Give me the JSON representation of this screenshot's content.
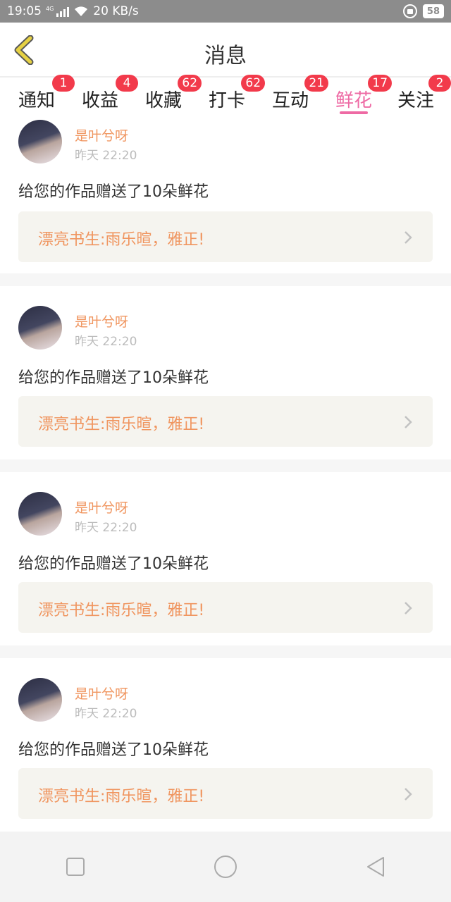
{
  "status_bar": {
    "time": "19:05",
    "network_label": "4G",
    "speed": "20 KB/s",
    "battery": "58"
  },
  "header": {
    "title": "消息",
    "back_icon": "chevron-left-icon",
    "back_color": "#e6d144"
  },
  "tabs": [
    {
      "label": "通知",
      "badge": "1"
    },
    {
      "label": "收益",
      "badge": "4"
    },
    {
      "label": "收藏",
      "badge": "62"
    },
    {
      "label": "打卡",
      "badge": "62"
    },
    {
      "label": "互动",
      "badge": "21"
    },
    {
      "label": "鲜花",
      "badge": "17",
      "active": true
    },
    {
      "label": "关注",
      "badge": "2"
    }
  ],
  "colors": {
    "accent_pink": "#ee6aa4",
    "badge_red": "#f23a4b",
    "name_orange": "#f0955f"
  },
  "messages": [
    {
      "user": "是叶兮呀",
      "time": "昨天 22:20",
      "text": "给您的作品赠送了10朵鲜花",
      "work": "漂亮书生:雨乐暄，雅正!"
    },
    {
      "user": "是叶兮呀",
      "time": "昨天 22:20",
      "text": "给您的作品赠送了10朵鲜花",
      "work": "漂亮书生:雨乐暄，雅正!"
    },
    {
      "user": "是叶兮呀",
      "time": "昨天 22:20",
      "text": "给您的作品赠送了10朵鲜花",
      "work": "漂亮书生:雨乐暄，雅正!"
    },
    {
      "user": "是叶兮呀",
      "time": "昨天 22:20",
      "text": "给您的作品赠送了10朵鲜花",
      "work": "漂亮书生:雨乐暄，雅正!"
    }
  ],
  "nav": {
    "recent_icon": "square-icon",
    "home_icon": "circle-icon",
    "back_icon": "triangle-back-icon"
  }
}
